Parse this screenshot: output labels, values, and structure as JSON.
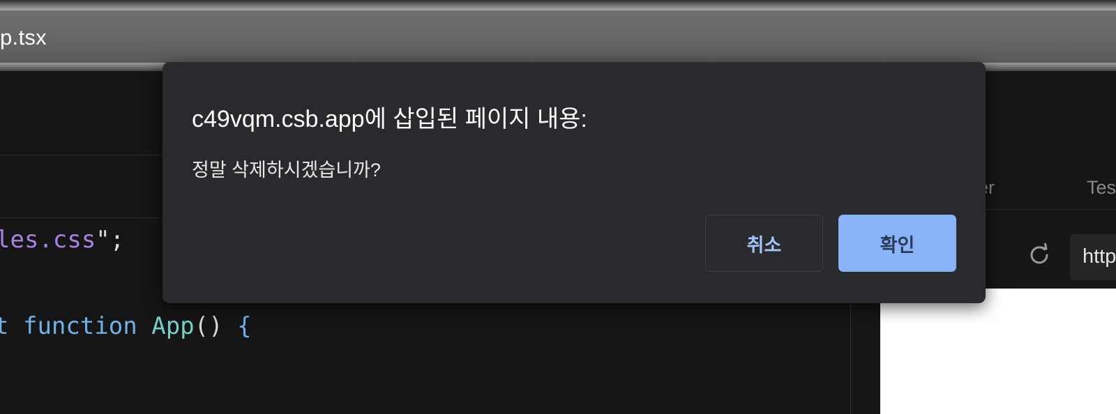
{
  "window": {
    "file_title": "p.tsx"
  },
  "editor": {
    "line1": {
      "string": "les.css",
      "quote": "\"",
      "semicolon": ";"
    },
    "line2": {
      "keyword_tail": "t",
      "keyword": "function",
      "name": "App",
      "parens": "()",
      "brace": "{"
    }
  },
  "preview_panel": {
    "tab_partial_1": "er",
    "tab_partial_2": "Tes",
    "url_partial": "http",
    "refresh_icon": "refresh-icon"
  },
  "dialog": {
    "title": "c49vqm.csb.app에 삽입된 페이지 내용:",
    "message": "정말 삭제하시겠습니까?",
    "cancel_label": "취소",
    "ok_label": "확인",
    "colors": {
      "background": "#292a2e",
      "primary": "#8ab4f8",
      "primary_text": "#2a3b57",
      "secondary_text": "#a2c4f6"
    }
  }
}
